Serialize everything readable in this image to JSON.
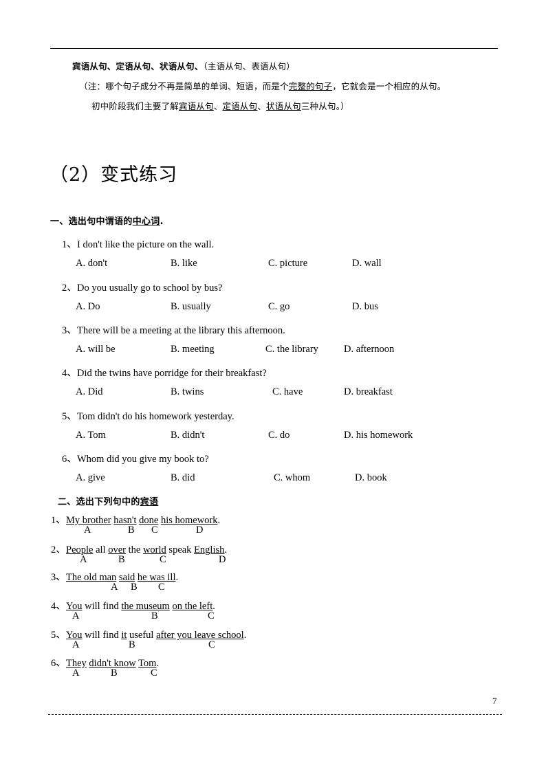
{
  "document": {
    "page_number": "7"
  },
  "intro": {
    "line1_bold": "宾语从句、定语从句、状语从句、",
    "line1_rest": "（主语从句、表语从句）",
    "line2_a": "（注：哪个句子成分不再是简单的单词、短语，而是个",
    "line2_u": "完整的句子",
    "line2_b": "，它就会是一个相应的从句。",
    "line3_a": "初中阶段我们主要了解",
    "line3_u1": "宾语从句",
    "line3_sep1": "、",
    "line3_u2": "定语从句",
    "line3_sep2": "、",
    "line3_u3": "状语从句",
    "line3_b": "三种从句。）"
  },
  "title": "（2）变式练习",
  "section_one": {
    "heading_a": "一、选出句中谓语的",
    "heading_u": "中心词",
    "heading_b": ".",
    "questions": [
      {
        "num": "1、",
        "stem": "I don't like the picture on the wall.",
        "options": [
          "A. don't",
          "B. like",
          "C. picture",
          "D. wall"
        ]
      },
      {
        "num": "2、",
        "stem": "Do you usually go to school by bus?",
        "options": [
          "A. Do",
          "B. usually",
          "C. go",
          "D. bus"
        ]
      },
      {
        "num": "3、",
        "stem": "There will be a meeting at the library this afternoon.",
        "options": [
          "A. will be",
          "B. meeting",
          "C. the library",
          "D. afternoon"
        ]
      },
      {
        "num": "4、",
        "stem": "Did the twins have porridge for their breakfast?",
        "options": [
          "A. Did",
          "B. twins",
          "C. have",
          "D. breakfast"
        ]
      },
      {
        "num": "5、",
        "stem": "Tom didn't do his homework yesterday.",
        "options": [
          "A. Tom",
          "B. didn't",
          "C. do",
          "D. his homework"
        ]
      },
      {
        "num": "6、",
        "stem": "Whom did you give my book to?",
        "options": [
          "A. give",
          "B. did",
          "C. whom",
          "D. book"
        ]
      }
    ]
  },
  "section_two": {
    "heading_a": "二、选出下列句中的",
    "heading_u": "宾语",
    "questions": [
      {
        "num": "1、",
        "parts": [
          {
            "text": "My brother",
            "underline": true
          },
          {
            "text": " ",
            "underline": false
          },
          {
            "text": "hasn't",
            "underline": true
          },
          {
            "text": " ",
            "underline": false
          },
          {
            "text": "done",
            "underline": true
          },
          {
            "text": " ",
            "underline": false
          },
          {
            "text": "his homework",
            "underline": true
          },
          {
            "text": ".",
            "underline": false
          }
        ],
        "letters": [
          "A",
          "B",
          "C",
          "D"
        ]
      },
      {
        "num": "2、",
        "parts": [
          {
            "text": "People",
            "underline": true
          },
          {
            "text": " all ",
            "underline": false
          },
          {
            "text": "over",
            "underline": true
          },
          {
            "text": " the ",
            "underline": false
          },
          {
            "text": "world",
            "underline": true
          },
          {
            "text": " speak ",
            "underline": false
          },
          {
            "text": "English",
            "underline": true
          },
          {
            "text": ".",
            "underline": false
          }
        ],
        "letters": [
          "A",
          "B",
          "C",
          "D"
        ]
      },
      {
        "num": "3、",
        "parts": [
          {
            "text": "The old man",
            "underline": true
          },
          {
            "text": " ",
            "underline": false
          },
          {
            "text": "said",
            "underline": true
          },
          {
            "text": " ",
            "underline": false
          },
          {
            "text": "he was ill",
            "underline": true
          },
          {
            "text": ".",
            "underline": false
          }
        ],
        "letters": [
          "A",
          "B",
          "C"
        ]
      },
      {
        "num": "4、",
        "parts": [
          {
            "text": "You",
            "underline": true
          },
          {
            "text": " will find ",
            "underline": false
          },
          {
            "text": "the museum",
            "underline": true
          },
          {
            "text": " ",
            "underline": false
          },
          {
            "text": "on the left",
            "underline": true
          },
          {
            "text": ".",
            "underline": false
          }
        ],
        "letters": [
          "A",
          "B",
          "C"
        ]
      },
      {
        "num": "5、",
        "parts": [
          {
            "text": "You",
            "underline": true
          },
          {
            "text": " will find ",
            "underline": false
          },
          {
            "text": "it",
            "underline": true
          },
          {
            "text": " useful ",
            "underline": false
          },
          {
            "text": "after you leave school",
            "underline": true
          },
          {
            "text": ".",
            "underline": false
          }
        ],
        "letters": [
          "A",
          "B",
          "C"
        ]
      },
      {
        "num": "6、",
        "parts": [
          {
            "text": "They",
            "underline": true
          },
          {
            "text": " ",
            "underline": false
          },
          {
            "text": "didn't know",
            "underline": true
          },
          {
            "text": " ",
            "underline": false
          },
          {
            "text": "Tom",
            "underline": true
          },
          {
            "text": ".",
            "underline": false
          }
        ],
        "letters": [
          "A",
          "B",
          "C"
        ]
      }
    ]
  },
  "layout": {
    "mc_question_tops": [
      344,
      407,
      469,
      531,
      594,
      656
    ],
    "mc_option_tops": [
      375,
      438,
      500,
      562,
      625,
      687
    ],
    "mc_option_lefts": [
      [
        110,
        248,
        390,
        512
      ],
      [
        110,
        248,
        390,
        512
      ],
      [
        110,
        248,
        386,
        500
      ],
      [
        110,
        248,
        396,
        500
      ],
      [
        110,
        248,
        390,
        500
      ],
      [
        110,
        248,
        398,
        516
      ]
    ],
    "ul_question_tops": [
      745,
      788,
      828,
      870,
      912,
      953
    ],
    "ul_letter_lefts": [
      [
        122,
        186,
        220,
        285
      ],
      [
        116,
        172,
        232,
        318
      ],
      [
        161,
        190,
        230
      ],
      [
        105,
        220,
        302
      ],
      [
        105,
        187,
        303
      ],
      [
        105,
        161,
        219
      ]
    ]
  }
}
